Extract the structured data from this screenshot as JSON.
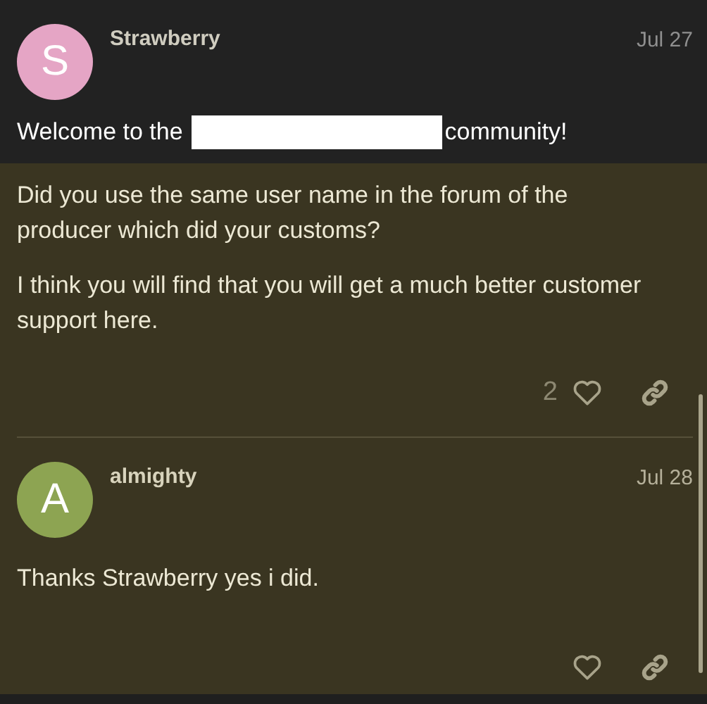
{
  "posts": [
    {
      "author": "Strawberry",
      "date": "Jul 27",
      "avatar_letter": "S",
      "color": "#e5a5c5",
      "intro": {
        "before": "Welcome to the",
        "redacted": true,
        "after": "community!"
      },
      "paragraphs": [
        "Did you use the same user name in the forum of the producer which did your customs?",
        "I think you will find that you will get a much better customer support here."
      ],
      "like_count": "2"
    },
    {
      "author": "almighty",
      "date": "Jul 28",
      "avatar_letter": "A",
      "color": "#8da452",
      "paragraphs": [
        "Thanks Strawberry yes i did."
      ]
    }
  ]
}
